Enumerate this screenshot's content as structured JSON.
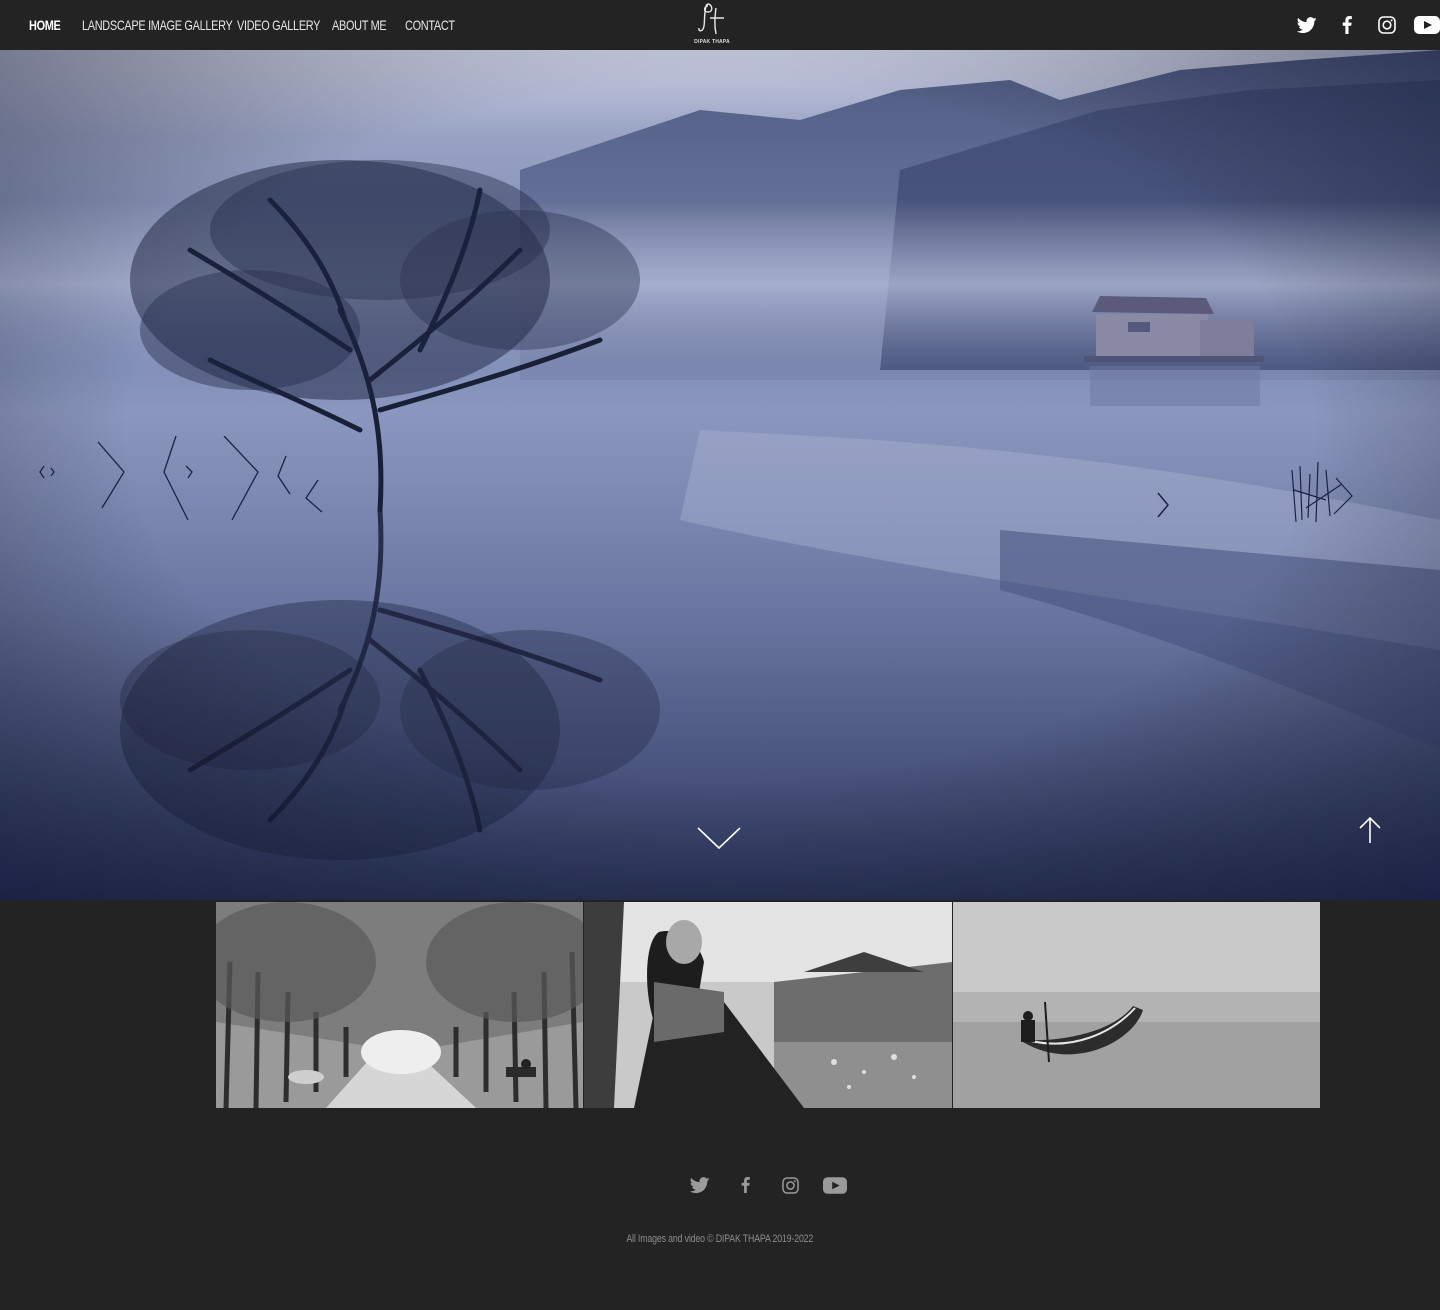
{
  "nav": {
    "items": [
      {
        "label": "HOME",
        "active": true
      },
      {
        "label": "LANDSCAPE IMAGE GALLERY",
        "active": false
      },
      {
        "label": "VIDEO GALLERY",
        "active": false
      },
      {
        "label": "ABOUT ME",
        "active": false
      },
      {
        "label": "CONTACT",
        "active": false
      }
    ]
  },
  "logo": {
    "text": "DIPAK THAPA",
    "mark": "Dt"
  },
  "social": [
    "twitter-icon",
    "facebook-icon",
    "instagram-icon",
    "youtube-icon"
  ],
  "hero": {
    "image": "misty lake with tree reflection and floating house",
    "controls": [
      "chevron-down-icon",
      "scroll-to-top-icon"
    ]
  },
  "thumbnails": [
    {
      "image": "tree-lined autumn road in black and white"
    },
    {
      "image": "woman sitting by a lake in black and white"
    },
    {
      "image": "boatman rowing on calm water in black and white"
    }
  ],
  "footer": {
    "copyright": "All Images and video © DIPAK THAPA 2019-2022"
  },
  "colors": {
    "background": "#232323",
    "nav_text": "#e6e6e6",
    "footer_text": "#8c8c8c",
    "icon_footer": "#9a9a9a"
  }
}
